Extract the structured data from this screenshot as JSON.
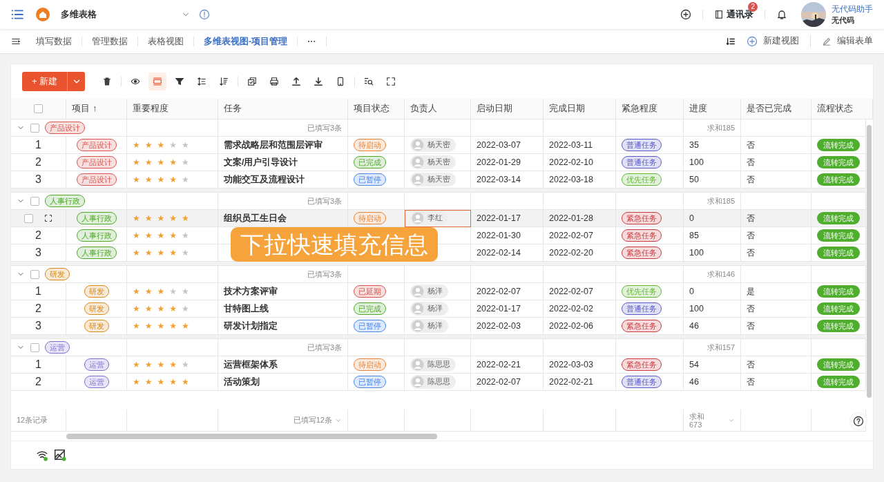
{
  "app_bar": {
    "title": "多维表格",
    "contacts": "通讯录",
    "contacts_badge": "2",
    "user_name": "无代码助手",
    "user_org": "无代码"
  },
  "view_tabs": [
    {
      "label": "填写数据",
      "selected": false
    },
    {
      "label": "管理数据",
      "selected": false
    },
    {
      "label": "表格视图",
      "selected": false
    },
    {
      "label": "多维表视图-项目管理",
      "selected": true
    }
  ],
  "view_more": "···",
  "view_actions": [
    {
      "kind": "add",
      "label": "新建视图"
    },
    {
      "kind": "edit",
      "label": "编辑表单"
    }
  ],
  "toolbar": {
    "new_button": "+ 新建",
    "tools": [
      {
        "kind": "trash",
        "selected": false
      },
      {
        "kind": "eye",
        "selected": false
      },
      {
        "kind": "rowheight",
        "selected": true
      },
      {
        "kind": "filter",
        "selected": false
      },
      {
        "kind": "sortasc",
        "selected": false
      },
      {
        "kind": "sortdesc",
        "selected": false
      },
      {
        "kind": "copy",
        "selected": false
      },
      {
        "kind": "print",
        "selected": false
      },
      {
        "kind": "upload",
        "selected": false
      },
      {
        "kind": "download",
        "selected": false
      },
      {
        "kind": "phone",
        "selected": false
      },
      {
        "kind": "searchlist",
        "selected": false
      },
      {
        "kind": "fullscreen",
        "selected": false
      }
    ]
  },
  "table": {
    "columns": [
      "项目",
      "重要程度",
      "任务",
      "项目状态",
      "负责人",
      "启动日期",
      "完成日期",
      "紧急程度",
      "进度",
      "是否已完成",
      "流程状态"
    ],
    "sort_indicator": "↑",
    "select_all_checked": false,
    "groups": [
      {
        "tag": "产品设计",
        "checked": false,
        "color": "#d9534f",
        "filled_count": "已填写3条",
        "sum": "求和185",
        "rows": [
          {
            "number": "1",
            "hovered": false,
            "tag": "产品设计",
            "stars": 3,
            "task": "需求战略层和范围层评审",
            "status": {
              "text": "待启动",
              "color": "#e8833a"
            },
            "owner": "杨天密",
            "owner_selected": false,
            "start": "2022-03-07",
            "end": "2022-03-11",
            "urgency": {
              "text": "普通任务",
              "color": "#5b5bc8"
            },
            "progress": "35",
            "done": "否",
            "flow": "流转完成"
          },
          {
            "number": "2",
            "hovered": false,
            "tag": "产品设计",
            "stars": 4,
            "task": "文案/用户引导设计",
            "status": {
              "text": "已完成",
              "color": "#4fa82a"
            },
            "owner": "杨天密",
            "owner_selected": false,
            "start": "2022-01-29",
            "end": "2022-02-10",
            "urgency": {
              "text": "普通任务",
              "color": "#5b5bc8"
            },
            "progress": "100",
            "done": "否",
            "flow": "流转完成"
          },
          {
            "number": "3",
            "hovered": false,
            "tag": "产品设计",
            "stars": 4,
            "task": "功能交互及流程设计",
            "status": {
              "text": "已暂停",
              "color": "#4a86e8"
            },
            "owner": "杨天密",
            "owner_selected": false,
            "start": "2022-03-14",
            "end": "2022-03-18",
            "urgency": {
              "text": "优先任务",
              "color": "#5fb832"
            },
            "progress": "50",
            "done": "否",
            "flow": "流转完成"
          }
        ]
      },
      {
        "tag": "人事行政",
        "checked": false,
        "color": "#4fa82a",
        "filled_count": "已填写3条",
        "sum": "求和185",
        "rows": [
          {
            "hovered": true,
            "checked": false,
            "tag": "人事行政",
            "stars": 5,
            "task": "组织员工生日会",
            "status": {
              "text": "待启动",
              "color": "#e8833a"
            },
            "owner": "李红",
            "owner_selected": true,
            "start": "2022-01-17",
            "end": "2022-01-28",
            "urgency": {
              "text": "紧急任务",
              "color": "#c9393e"
            },
            "progress": "0",
            "done": "否",
            "flow": "流转完成"
          },
          {
            "number": "2",
            "hovered": false,
            "tag": "人事行政",
            "stars": 4,
            "owner_selected": false,
            "start": "2022-01-30",
            "end": "2022-02-07",
            "urgency": {
              "text": "紧急任务",
              "color": "#c9393e"
            },
            "progress": "85",
            "done": "否",
            "flow": "流转完成"
          },
          {
            "number": "3",
            "hovered": false,
            "tag": "人事行政",
            "stars": 4,
            "owner_selected": false,
            "start": "2022-02-14",
            "end": "2022-02-20",
            "urgency": {
              "text": "紧急任务",
              "color": "#c9393e"
            },
            "progress": "100",
            "done": "否",
            "flow": "流转完成"
          }
        ]
      },
      {
        "tag": "研发",
        "checked": false,
        "color": "#d98a1c",
        "filled_count": "已填写3条",
        "sum": "求和146",
        "rows": [
          {
            "number": "1",
            "hovered": false,
            "tag": "研发",
            "stars": 3,
            "task": "技术方案评审",
            "status": {
              "text": "已延期",
              "color": "#d9534f"
            },
            "owner": "杨洋",
            "owner_selected": false,
            "start": "2022-02-07",
            "end": "2022-02-07",
            "urgency": {
              "text": "优先任务",
              "color": "#5fb832"
            },
            "progress": "0",
            "done": "是",
            "flow": "流转完成"
          },
          {
            "number": "2",
            "hovered": false,
            "tag": "研发",
            "stars": 4,
            "task": "甘特图上线",
            "status": {
              "text": "已完成",
              "color": "#4fa82a"
            },
            "owner": "杨洋",
            "owner_selected": false,
            "start": "2022-01-17",
            "end": "2022-02-02",
            "urgency": {
              "text": "普通任务",
              "color": "#5b5bc8"
            },
            "progress": "100",
            "done": "否",
            "flow": "流转完成"
          },
          {
            "number": "3",
            "hovered": false,
            "tag": "研发",
            "stars": 5,
            "task": "研发计划指定",
            "status": {
              "text": "已暂停",
              "color": "#4a86e8"
            },
            "owner": "杨洋",
            "owner_selected": false,
            "start": "2022-02-03",
            "end": "2022-02-06",
            "urgency": {
              "text": "紧急任务",
              "color": "#c9393e"
            },
            "progress": "46",
            "done": "否",
            "flow": "流转完成"
          }
        ]
      },
      {
        "tag": "运营",
        "checked": false,
        "color": "#7b6fd0",
        "filled_count": "已填写3条",
        "sum": "求和157",
        "rows": [
          {
            "number": "1",
            "hovered": false,
            "tag": "运营",
            "stars": 4,
            "task": "运营框架体系",
            "status": {
              "text": "待启动",
              "color": "#e8833a"
            },
            "owner": "陈思思",
            "owner_selected": false,
            "start": "2022-02-21",
            "end": "2022-03-03",
            "urgency": {
              "text": "紧急任务",
              "color": "#c9393e"
            },
            "progress": "54",
            "done": "否",
            "flow": "流转完成"
          },
          {
            "number": "2",
            "hovered": false,
            "tag": "运营",
            "stars": 5,
            "task": "活动策划",
            "status": {
              "text": "已暂停",
              "color": "#4a86e8"
            },
            "owner": "陈思思",
            "owner_selected": false,
            "start": "2022-02-07",
            "end": "2022-02-21",
            "urgency": {
              "text": "普通任务",
              "color": "#5b5bc8"
            },
            "progress": "46",
            "done": "否",
            "flow": "流转完成"
          }
        ]
      }
    ]
  },
  "footer": {
    "records": "12条记录",
    "filled": "已填写12条",
    "sum": "求和673"
  },
  "overlay_caption": "下拉快速填充信息"
}
